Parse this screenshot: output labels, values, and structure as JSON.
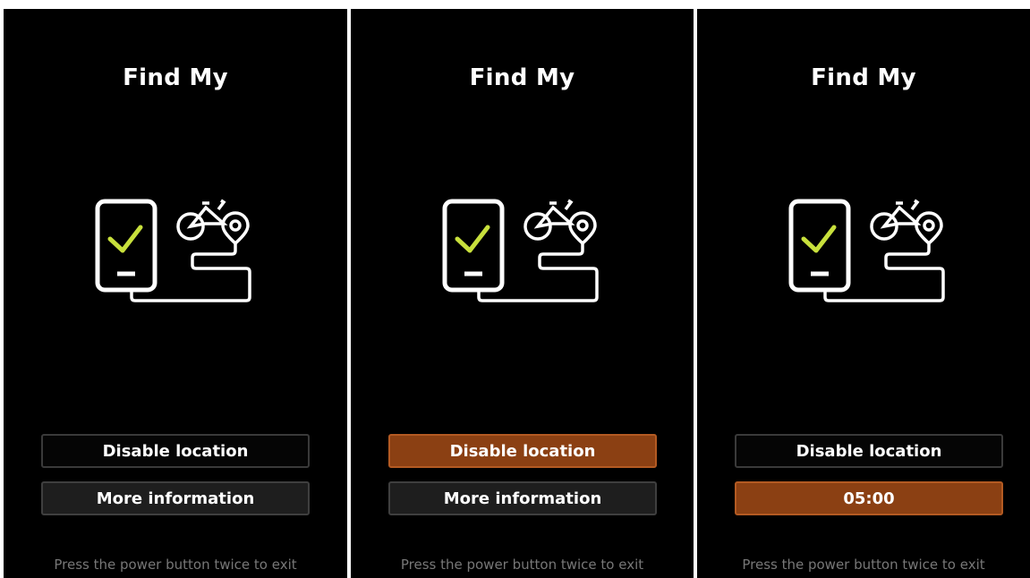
{
  "panels": [
    {
      "title": "Find My",
      "buttons": [
        "Disable location",
        "More information"
      ],
      "footer": "Press the power button twice to exit"
    },
    {
      "title": "Find My",
      "buttons": [
        "Disable location",
        "More information"
      ],
      "footer": "Press the power button twice to exit"
    },
    {
      "title": "Find My",
      "buttons": [
        "Disable location",
        "05:00"
      ],
      "footer": "Press the power button twice to exit"
    }
  ],
  "colors": {
    "check": "#c8e03c",
    "active_button": "#8b4013",
    "background": "#000000"
  },
  "icons": [
    "phone-check-icon",
    "bicycle-location-pin-icon"
  ]
}
